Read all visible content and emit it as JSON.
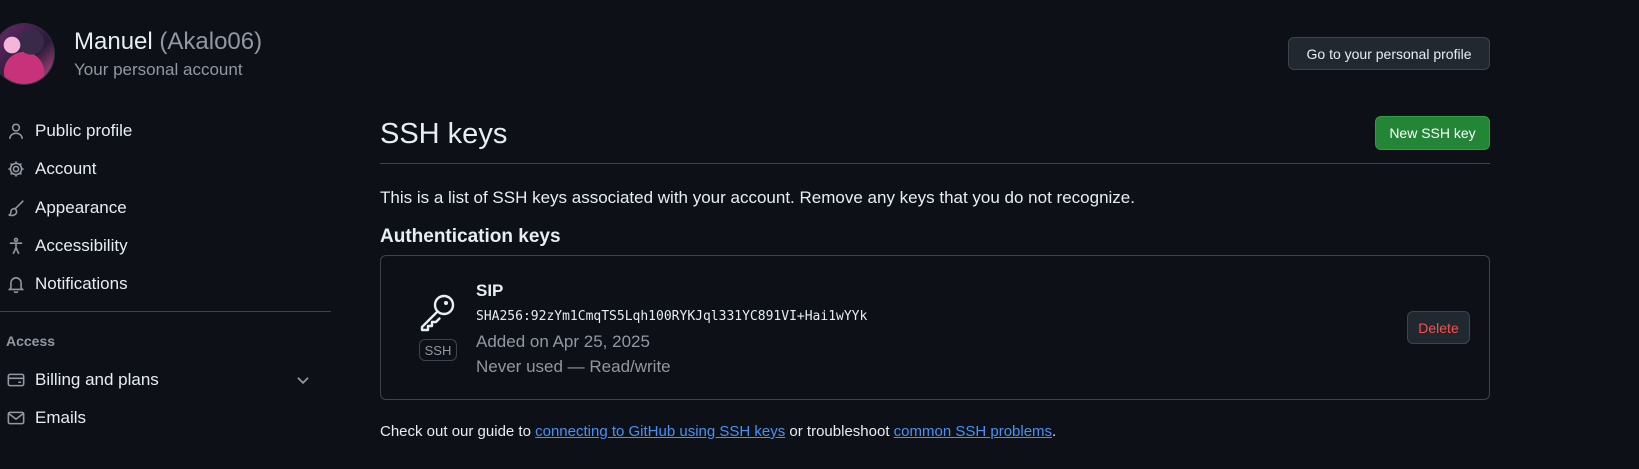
{
  "header": {
    "display_name": "Manuel",
    "username": "(Akalo06)",
    "subtitle": "Your personal account",
    "profile_button": "Go to your personal profile"
  },
  "sidebar": {
    "items": [
      {
        "label": "Public profile",
        "icon": "person-icon"
      },
      {
        "label": "Account",
        "icon": "gear-icon"
      },
      {
        "label": "Appearance",
        "icon": "paintbrush-icon"
      },
      {
        "label": "Accessibility",
        "icon": "accessibility-icon"
      },
      {
        "label": "Notifications",
        "icon": "bell-icon"
      }
    ],
    "access_heading": "Access",
    "access_items": [
      {
        "label": "Billing and plans",
        "icon": "credit-card-icon",
        "expandable": true
      },
      {
        "label": "Emails",
        "icon": "mail-icon"
      }
    ]
  },
  "main": {
    "title": "SSH keys",
    "new_button": "New SSH key",
    "intro": "This is a list of SSH keys associated with your account. Remove any keys that you do not recognize.",
    "auth_heading": "Authentication keys",
    "key": {
      "title": "SIP",
      "fingerprint": "SHA256:92zYm1CmqTS5Lqh100RYKJql331YC891VI+Hai1wYYk",
      "added": "Added on Apr 25, 2025",
      "usage": "Never used — Read/write",
      "badge": "SSH",
      "delete_label": "Delete"
    },
    "footer": {
      "prefix": "Check out our guide to ",
      "link1": "connecting to GitHub using SSH keys",
      "middle": " or troubleshoot ",
      "link2": "common SSH problems",
      "suffix": "."
    }
  },
  "colors": {
    "background": "#0d1117",
    "primary_button": "#238636",
    "danger": "#f85149",
    "link": "#4493f8"
  }
}
